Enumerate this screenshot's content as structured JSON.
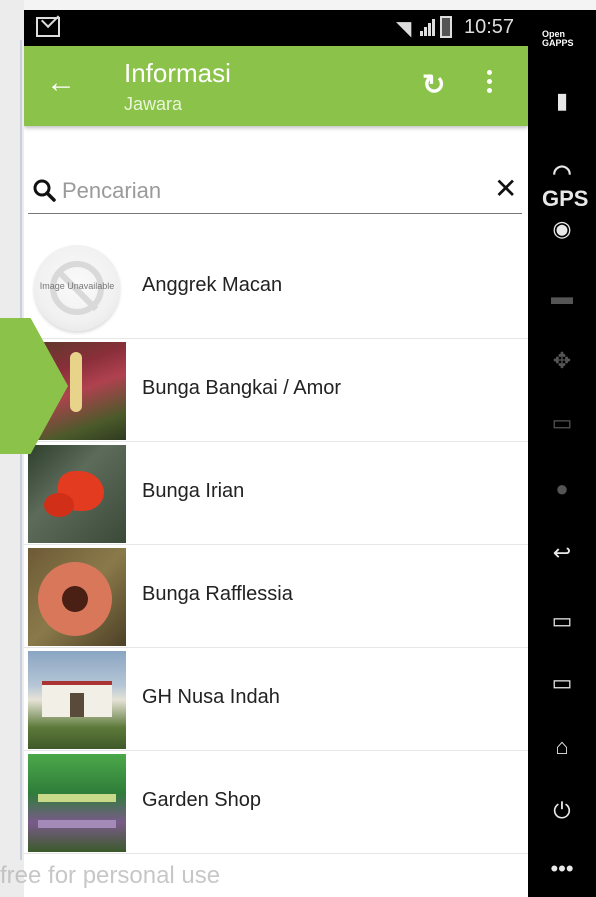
{
  "status_bar": {
    "time": "10:57"
  },
  "app_bar": {
    "title": "Informasi",
    "subtitle": "Jawara"
  },
  "search": {
    "placeholder": "Pencarian"
  },
  "items": [
    {
      "label": "Anggrek Macan",
      "image": "image-unavailable",
      "image_text": "Image Unavailable"
    },
    {
      "label": "Bunga Bangkai / Amor",
      "image": "photo"
    },
    {
      "label": "Bunga Irian",
      "image": "photo"
    },
    {
      "label": "Bunga Rafflessia",
      "image": "photo"
    },
    {
      "label": "GH Nusa Indah",
      "image": "photo"
    },
    {
      "label": "Garden Shop",
      "image": "photo"
    }
  ],
  "nav_rail": {
    "opengapps": "Open GAPPS",
    "gps": "GPS",
    "icons": [
      "battery-icon",
      "gps-icon",
      "webcam-icon",
      "clapperboard-icon",
      "dpad-icon",
      "id-icon",
      "media-icon",
      "back-icon",
      "recents-icon",
      "menu-icon",
      "home-icon",
      "power-icon",
      "more-icon"
    ]
  },
  "watermark": "free for personal use",
  "colors": {
    "accent": "#8bc34a",
    "nav_rail": "#000000"
  }
}
